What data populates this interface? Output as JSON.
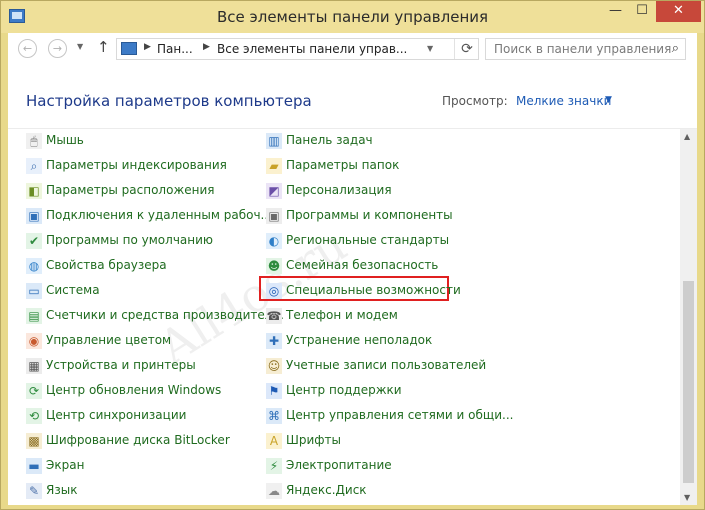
{
  "window": {
    "title": "Все элементы панели управления",
    "minimize_glyph": "—",
    "maximize_glyph": "☐",
    "close_glyph": "✕"
  },
  "navigation": {
    "back_glyph": "←",
    "forward_glyph": "→",
    "up_glyph": "↑",
    "refresh_glyph": "⟳"
  },
  "address_bar": {
    "crumbs": [
      "Пан...",
      "Все элементы панели управ..."
    ]
  },
  "search": {
    "placeholder": "Поиск в панели управления"
  },
  "header": {
    "title": "Настройка параметров компьютера",
    "view_label": "Просмотр:",
    "view_value": "Мелкие значки"
  },
  "items_left": [
    {
      "label": "Мышь",
      "icon": "mouse-icon"
    },
    {
      "label": "Параметры индексирования",
      "icon": "indexing-icon"
    },
    {
      "label": "Параметры расположения",
      "icon": "location-icon"
    },
    {
      "label": "Подключения к удаленным рабоч...",
      "icon": "remote-desktop-icon"
    },
    {
      "label": "Программы по умолчанию",
      "icon": "default-programs-icon"
    },
    {
      "label": "Свойства браузера",
      "icon": "internet-options-icon"
    },
    {
      "label": "Система",
      "icon": "system-icon"
    },
    {
      "label": "Счетчики и средства производител...",
      "icon": "performance-icon"
    },
    {
      "label": "Управление цветом",
      "icon": "color-management-icon"
    },
    {
      "label": "Устройства и принтеры",
      "icon": "devices-printers-icon"
    },
    {
      "label": "Центр обновления Windows",
      "icon": "windows-update-icon"
    },
    {
      "label": "Центр синхронизации",
      "icon": "sync-center-icon"
    },
    {
      "label": "Шифрование диска BitLocker",
      "icon": "bitlocker-icon"
    },
    {
      "label": "Экран",
      "icon": "display-icon"
    },
    {
      "label": "Язык",
      "icon": "language-icon"
    }
  ],
  "items_right": [
    {
      "label": "Панель задач",
      "icon": "taskbar-icon"
    },
    {
      "label": "Параметры папок",
      "icon": "folder-options-icon"
    },
    {
      "label": "Персонализация",
      "icon": "personalization-icon"
    },
    {
      "label": "Программы и компоненты",
      "icon": "programs-features-icon"
    },
    {
      "label": "Региональные стандарты",
      "icon": "region-icon"
    },
    {
      "label": "Семейная безопасность",
      "icon": "family-safety-icon"
    },
    {
      "label": "Специальные возможности",
      "icon": "ease-of-access-icon"
    },
    {
      "label": "Телефон и модем",
      "icon": "phone-modem-icon"
    },
    {
      "label": "Устранение неполадок",
      "icon": "troubleshooting-icon"
    },
    {
      "label": "Учетные записи пользователей",
      "icon": "user-accounts-icon"
    },
    {
      "label": "Центр поддержки",
      "icon": "action-center-icon"
    },
    {
      "label": "Центр управления сетями и общи...",
      "icon": "network-sharing-icon"
    },
    {
      "label": "Шрифты",
      "icon": "fonts-icon"
    },
    {
      "label": "Электропитание",
      "icon": "power-options-icon"
    },
    {
      "label": "Яндекс.Диск",
      "icon": "yandex-disk-icon"
    }
  ],
  "highlighted_item": "Специальные возможности",
  "watermark": "All4os.ru",
  "colors": {
    "item_text": "#1f6b1f",
    "title_text": "#1e3a8a",
    "highlight_border": "#e02020",
    "close_button": "#c7483a"
  }
}
